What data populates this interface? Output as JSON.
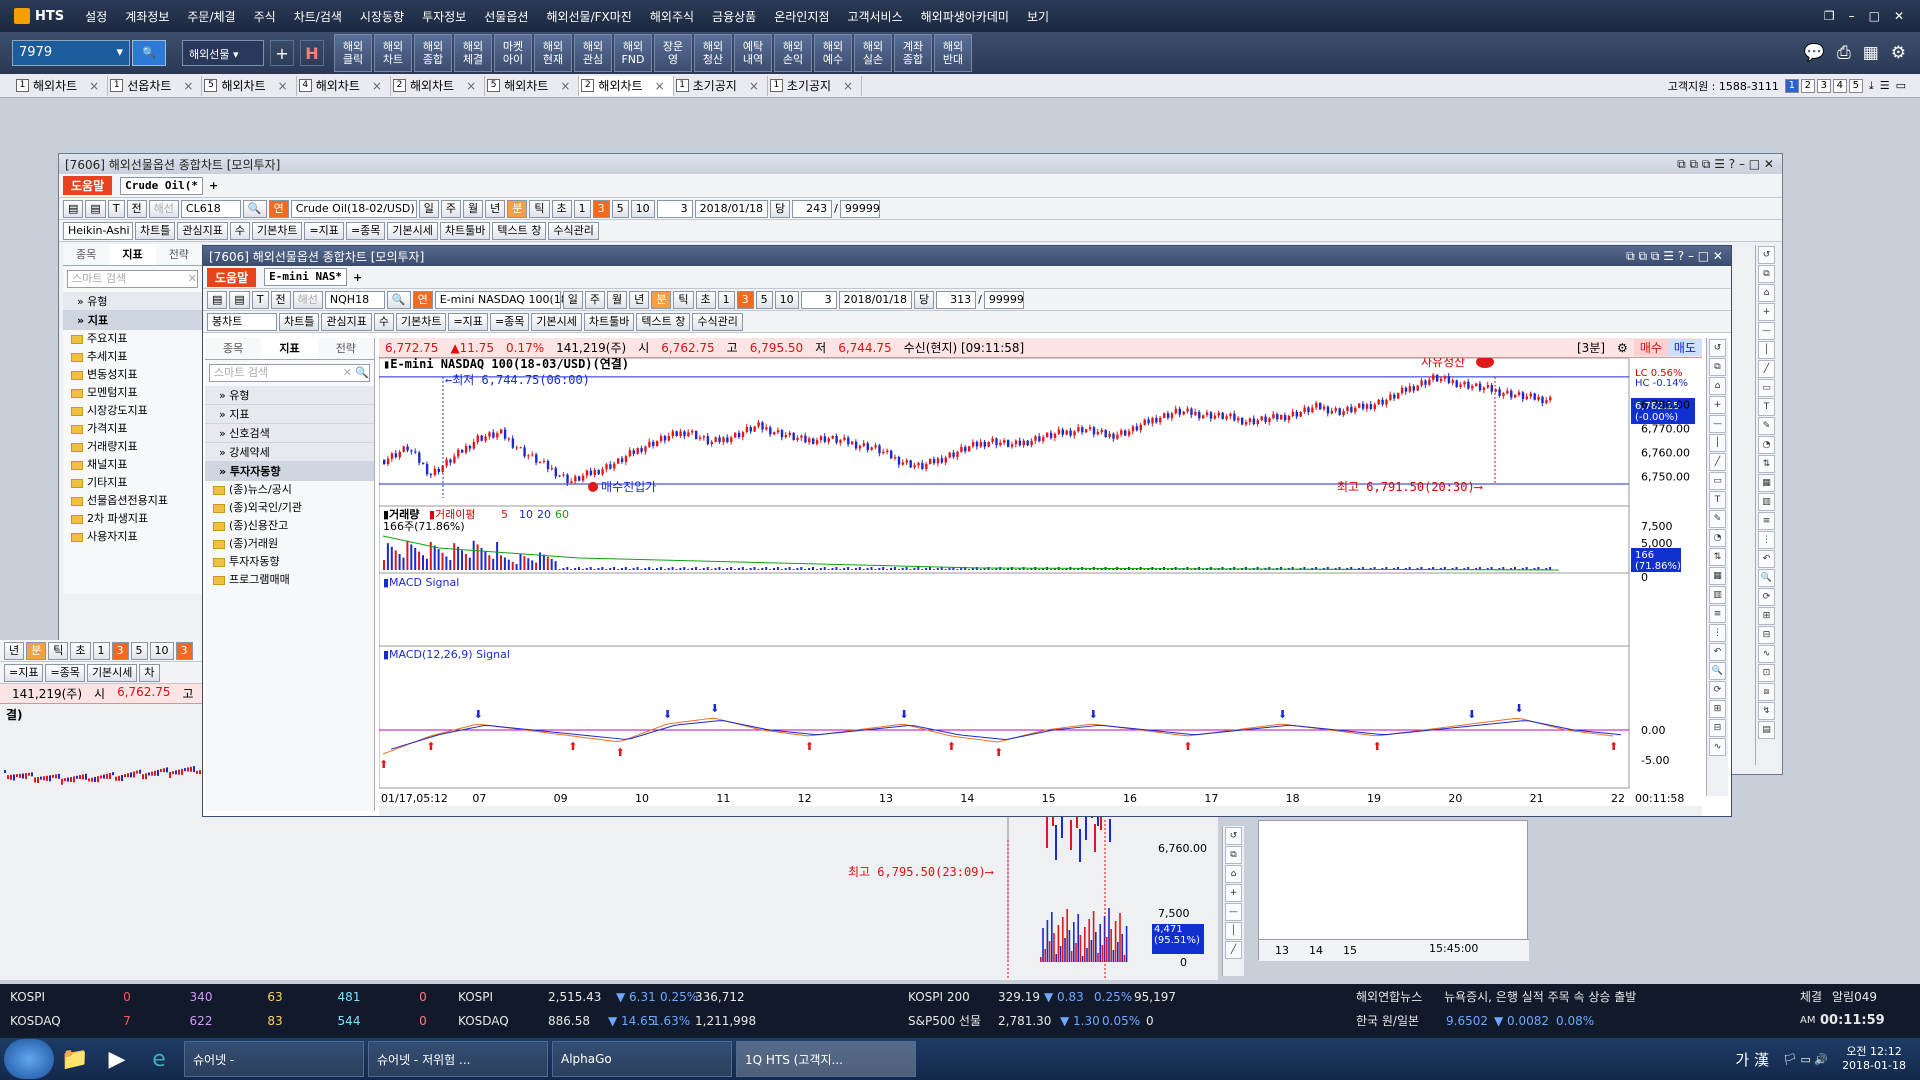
{
  "app": {
    "logo": "HTS",
    "menu": [
      "설정",
      "계좌정보",
      "주문/체결",
      "주식",
      "차트/검색",
      "시장동향",
      "투자정보",
      "선물옵션",
      "해외선물/FX마진",
      "해외주식",
      "금융상품",
      "온라인지점",
      "고객서비스",
      "해외파생아카데미",
      "보기"
    ]
  },
  "toolbar": {
    "code": "7979",
    "market": "해외선물",
    "buttons": [
      "해외\n클릭",
      "해외\n차트",
      "해외\n종합",
      "해외\n체결",
      "마켓\n아이",
      "해외\n현재",
      "해외\n관심",
      "해외\nFND",
      "장운\n영",
      "해외\n청산",
      "예탁\n내역",
      "해외\n손익",
      "해외\n예수",
      "해외\n실손",
      "계좌\n종합",
      "해외\n반대"
    ]
  },
  "tabs": [
    {
      "n": "1",
      "label": "해외차트"
    },
    {
      "n": "1",
      "label": "선옵차트"
    },
    {
      "n": "5",
      "label": "해외차트"
    },
    {
      "n": "4",
      "label": "해외차트"
    },
    {
      "n": "2",
      "label": "해외차트"
    },
    {
      "n": "5",
      "label": "해외차트"
    },
    {
      "n": "2",
      "label": "해외차트",
      "active": true
    },
    {
      "n": "1",
      "label": "초기공지"
    },
    {
      "n": "1",
      "label": "초기공지"
    }
  ],
  "customer": {
    "label": "고객지원 : 1588-3111",
    "pages": [
      "1",
      "2",
      "3",
      "4",
      "5"
    ]
  },
  "back_window": {
    "title": "[7606] 해외선물옵션 종합차트 [모의투자]",
    "help": "도움말",
    "tab": "Crude Oil(*",
    "code": "CL618",
    "name": "Crude Oil(18-02/USD)",
    "period": [
      "일",
      "주",
      "월",
      "년",
      "분",
      "틱",
      "초"
    ],
    "nums": [
      "1",
      "3",
      "5",
      "10"
    ],
    "count": "3",
    "date": "2018/01/18",
    "dang": "당",
    "n1": "243",
    "n2": "99999",
    "chart_type": "Heikin-Ashi",
    "row2": [
      "차트틀",
      "관심지표",
      "수",
      "기본차트",
      "=지표",
      "=종목",
      "기본시세",
      "차트툴바",
      "텍스트 창",
      "수식관리"
    ],
    "side_tabs": [
      "종목",
      "지표",
      "전략"
    ],
    "search": "스마트 검색",
    "cats": [
      "유형",
      "지표"
    ],
    "folders": [
      "주요지표",
      "추세지표",
      "변동성지표",
      "모멘텀지표",
      "시장강도지표",
      "가격지표",
      "거래량지표",
      "채널지표",
      "기타지표",
      "선물옵션전용지표",
      "2차 파생지표",
      "사용자지표"
    ]
  },
  "left_window": {
    "row": [
      "년",
      "분",
      "틱",
      "초",
      "1",
      "3",
      "5",
      "10",
      "3"
    ],
    "row2": [
      "=지표",
      "=종목",
      "기본시세",
      "차"
    ],
    "quote": [
      "141,219(주)",
      "시",
      "6,762.75",
      "고",
      "6,7"
    ],
    "name": "결)",
    "label_high": "최고 6,795.50(23:09)⟶",
    "y1": "6,760.00",
    "vol1": "7,500",
    "vol_last": "4,471\n(95.51%)",
    "vol0": "0"
  },
  "main_window": {
    "title": "[7606] 해외선물옵션 종합차트 [모의투자]",
    "help": "도움말",
    "tab": "E-mini NAS*",
    "code": "NQH18",
    "name": "E-mini NASDAQ 100(18-",
    "period": [
      "일",
      "주",
      "월",
      "년",
      "분",
      "틱",
      "초"
    ],
    "nums": [
      "1",
      "3",
      "5",
      "10"
    ],
    "count": "3",
    "date": "2018/01/18",
    "dang": "당",
    "n1": "313",
    "n2": "99999",
    "chart_type": "봉차트",
    "row2": [
      "차트틀",
      "관심지표",
      "수",
      "기본차트",
      "=지표",
      "=종목",
      "기본시세",
      "차트툴바",
      "텍스트 창",
      "수식관리"
    ],
    "side_tabs": [
      "종목",
      "지표",
      "전략"
    ],
    "search": "스마트 검색",
    "cats": [
      "유형",
      "지표",
      "신호검색",
      "강세약세",
      "투자자동향"
    ],
    "folders": [
      "(종)뉴스/공시",
      "(종)외국인/기관",
      "(종)신용잔고",
      "(종)거래원",
      "투자자동향",
      "프로그램매매"
    ],
    "quote": {
      "price": "6,772.75",
      "change": "▲11.75",
      "pct": "0.17%",
      "vol": "141,219(주)",
      "open_l": "시",
      "open": "6,762.75",
      "high_l": "고",
      "high": "6,795.50",
      "low_l": "저",
      "low": "6,744.75",
      "recv": "수신(현지) [09:11:58]",
      "interval": "[3분]",
      "buy": "매수",
      "sell": "매도"
    },
    "chart_label": "E-mini NASDAQ 100(18-03/USD)(연결)",
    "low_note": "←최저 6,744.75(06:00)",
    "buy_note": "매수진입가",
    "high_note": "최고 6,791.50(20:30)⟶",
    "exit_note": "자유청산",
    "lc": "LC  0.56%",
    "hc": "HC -0.14%",
    "last_box": "6,782.25\n(-0.00%)",
    "yticks": [
      "6,780.00",
      "6,770.00",
      "6,760.00",
      "6,750.00"
    ],
    "vol_label": "거래량",
    "vol_ma": "거래이평",
    "vol_ma_nums": [
      "5",
      "10",
      "20",
      "60"
    ],
    "vol_value": "166주(71.86%)",
    "vol_ticks": [
      "7,500",
      "5,000",
      "2,500",
      "0"
    ],
    "vol_last": "166\n(71.86%)",
    "macd_label": "MACD Signal",
    "macd2_label": "MACD(12,26,9) Signal",
    "macd_ticks": [
      "0.00",
      "-5.00"
    ],
    "xticks": [
      "01/17,05:12",
      "07",
      "09",
      "10",
      "11",
      "12",
      "13",
      "14",
      "15",
      "16",
      "17",
      "18",
      "19",
      "20",
      "21",
      "22"
    ],
    "time": "00:11:58"
  },
  "right_window": {
    "xticks": [
      "13",
      "14",
      "15"
    ],
    "time": "15:45:00"
  },
  "bottom": {
    "r1": {
      "kospi": "KOSPI",
      "v": [
        "0",
        "340",
        "63",
        "481",
        "0"
      ],
      "k2": "KOSPI",
      "p": "2,515.43",
      "c": "▼ 6.31",
      "pct": "0.25%",
      "vol": "336,712",
      "k200": "KOSPI 200",
      "p2": "329.19",
      "c2": "▼ 0.83",
      "pct2": "0.25%",
      "vol2": "95,197",
      "news_l": "해외연합뉴스",
      "news": "뉴욕증시, 은행 실적 주목 속 상승 출발",
      "chk": "체결",
      "alarm": "알림049"
    },
    "r2": {
      "kosdaq": "KOSDAQ",
      "v": [
        "7",
        "622",
        "83",
        "544",
        "0"
      ],
      "k2": "KOSDAQ",
      "p": "886.58",
      "c": "▼ 14.65",
      "pct": "1.63%",
      "vol": "1,211,998",
      "sp": "S&P500 선물",
      "p2": "2,781.30",
      "c2": "▼ 1.30",
      "pct2": "0.05%",
      "vol2": "0",
      "fx_l": "한국 원/일본",
      "fx": "9.6502",
      "fxc": "▼ 0.0082",
      "fxp": "0.08%",
      "ampm": "AM",
      "clock": "00:11:59"
    }
  },
  "taskbar": {
    "tasks": [
      "슈어넷 -",
      "슈어넷 - 저위험 ...",
      "AlphaGo",
      "1Q HTS (고객지..."
    ],
    "ime": "가 漢",
    "time": "오전 12:12",
    "date": "2018-01-18"
  },
  "chart_data": {
    "type": "line",
    "series": [
      {
        "name": "E-mini NASDAQ 100(18-03/USD)(연결)",
        "values": [
          6757,
          6762,
          6751,
          6758,
          6766,
          6768,
          6760,
          6754,
          6748,
          6752,
          6756,
          6762,
          6766,
          6769,
          6764,
          6767,
          6771,
          6768,
          6765,
          6766,
          6764,
          6762,
          6757,
          6754,
          6758,
          6762,
          6765,
          6763,
          6766,
          6768,
          6770,
          6767,
          6769,
          6774,
          6777,
          6776,
          6775,
          6773,
          6774,
          6776,
          6779,
          6777,
          6779,
          6782,
          6787,
          6791,
          6789,
          6787,
          6785,
          6783,
          6782
        ]
      },
      {
        "name": "MACD(12,26,9)",
        "values": [
          -4,
          -1,
          1,
          0,
          -1,
          -2,
          1,
          2,
          0,
          -1,
          0,
          1,
          -1,
          -2,
          0,
          1,
          0,
          -1,
          0,
          1,
          0,
          -1,
          0,
          1,
          2,
          0,
          -1
        ]
      }
    ],
    "ylim": [
      6742,
      6796
    ],
    "xticks": [
      "01/17,05:12",
      "07",
      "09",
      "10",
      "11",
      "12",
      "13",
      "14",
      "15",
      "16",
      "17",
      "18",
      "19",
      "20",
      "21",
      "22"
    ]
  }
}
